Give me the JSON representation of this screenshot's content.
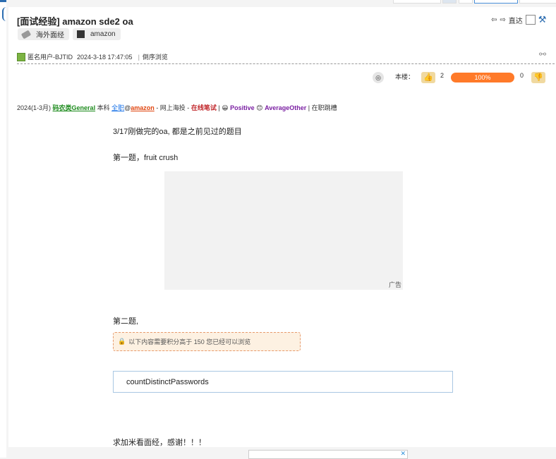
{
  "thread": {
    "title": "[面试经验] amazon sde2 oa",
    "tags": [
      "海外面经",
      "amazon"
    ],
    "header_controls": {
      "goto_label": "直达"
    }
  },
  "post": {
    "author": "匿名用户-BJTID",
    "timestamp": "2024-3-18 17:47:05",
    "reverse_browse": "倒序浏览",
    "floor_label": "本楼：",
    "upvotes": "2",
    "ratio": "100%",
    "ratio_value": 1.0,
    "downvotes": "0"
  },
  "meta": {
    "period": "2024(1-3月)",
    "category": "码农类General",
    "degree": "本科",
    "jobtype": "全职",
    "at": "@",
    "company": "amazon",
    "source": "- 网上海投 -",
    "format": "在线笔试",
    "sep": "|",
    "experience": "Positive",
    "difficulty": "AverageOther",
    "status": "| 在职跳槽"
  },
  "content": {
    "p1": "3/17刚做完的oa, 都是之前见过的题目",
    "p2": "第一题，fruit crush",
    "ad_label": "广告",
    "p3": "第二题,",
    "locked_notice": "以下内容需要积分高于 150 您已经可以浏览",
    "code": "countDistinctPasswords",
    "p4": "求加米看面经，感谢！！！"
  },
  "colors": {
    "accent": "#2b6cb0",
    "progress": "#ff7a29",
    "green": "#1b8a1b",
    "red": "#c0262a",
    "purple": "#7a1fa2"
  },
  "icons": [
    "tag-icon",
    "square-icon",
    "prev-arrow-icon",
    "next-arrow-icon",
    "wrench-icon",
    "link-icon",
    "share-icon",
    "thumbs-up-icon",
    "thumbs-down-icon",
    "lock-icon",
    "close-icon",
    "smiley-icon"
  ]
}
